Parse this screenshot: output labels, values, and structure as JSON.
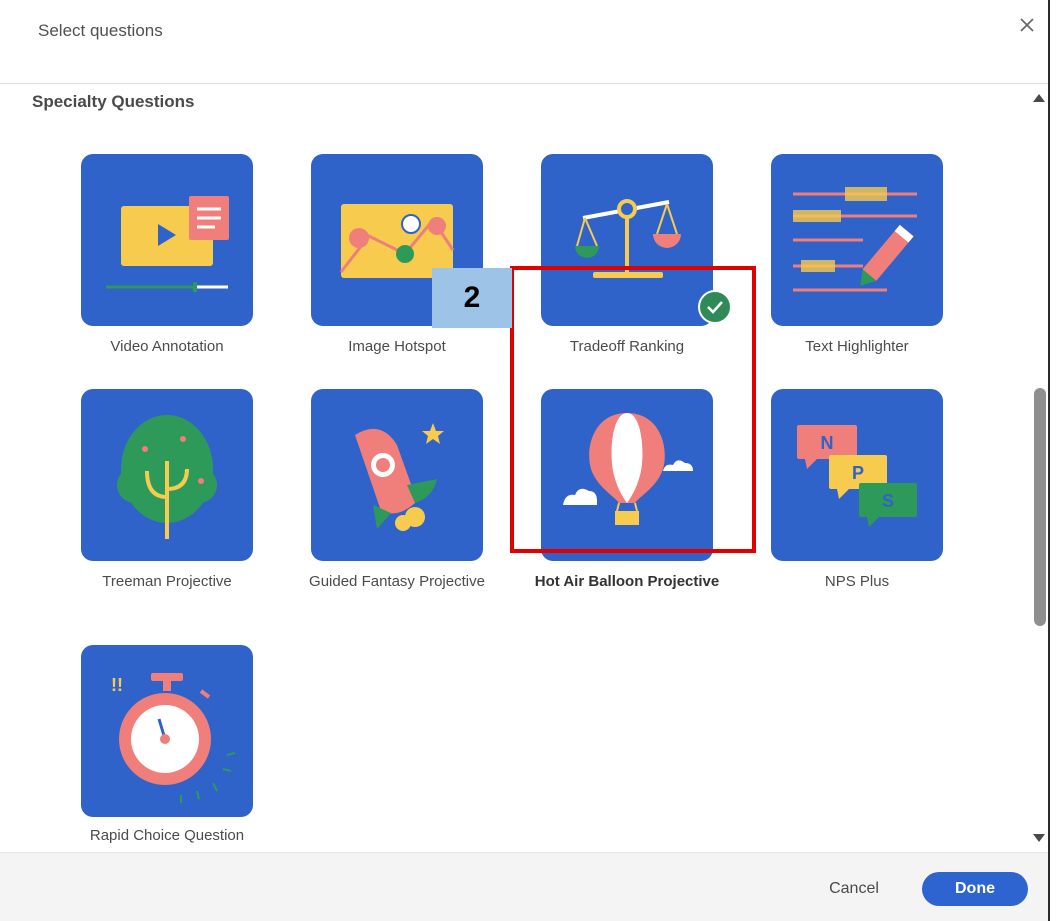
{
  "dialog": {
    "title": "Select questions"
  },
  "section": {
    "title": "Specialty Questions"
  },
  "tiles": [
    {
      "label": "Video Annotation",
      "icon": "video-annotation-icon"
    },
    {
      "label": "Image Hotspot",
      "icon": "image-hotspot-icon"
    },
    {
      "label": "Tradeoff Ranking",
      "icon": "tradeoff-ranking-icon"
    },
    {
      "label": "Text Highlighter",
      "icon": "text-highlighter-icon"
    },
    {
      "label": "Treeman Projective",
      "icon": "treeman-icon"
    },
    {
      "label": "Guided Fantasy Projective",
      "icon": "rocket-icon"
    },
    {
      "label": "Hot Air Balloon Projective",
      "icon": "hot-air-balloon-icon",
      "selected": true
    },
    {
      "label": "NPS Plus",
      "icon": "nps-plus-icon"
    },
    {
      "label": "Rapid Choice Question",
      "icon": "stopwatch-icon"
    }
  ],
  "annotation": {
    "step_number": "2"
  },
  "footer": {
    "cancel_label": "Cancel",
    "done_label": "Done"
  },
  "colors": {
    "tile_background": "#2f63c9",
    "primary_button": "#2e64d0",
    "selected_check": "#2e8b57",
    "highlight_border": "#e00000",
    "callout_background": "#9dc3e6"
  }
}
